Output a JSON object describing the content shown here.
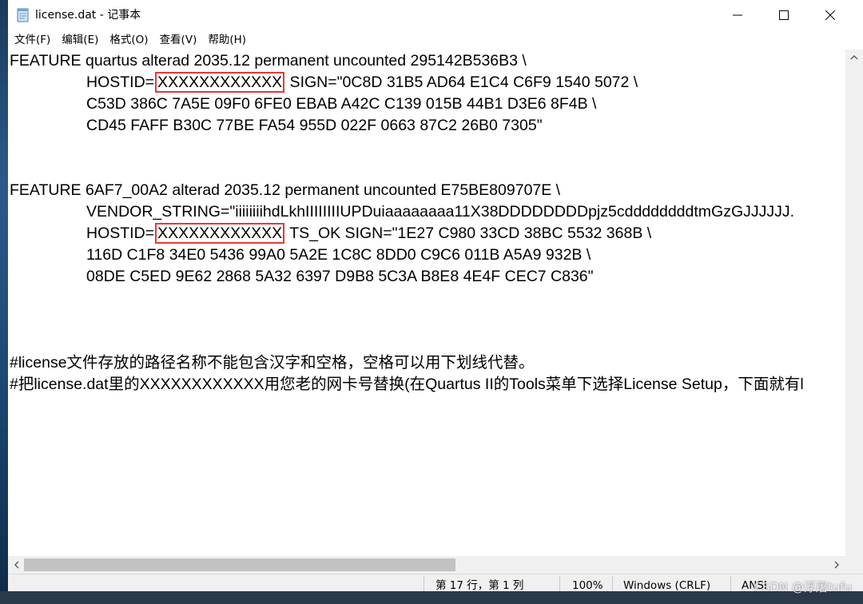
{
  "window": {
    "title": "license.dat - 记事本",
    "minimize_glyph": "—",
    "maximize_glyph": "☐",
    "close_glyph": "✕"
  },
  "menu": {
    "items": [
      "文件(F)",
      "编辑(E)",
      "格式(O)",
      "查看(V)",
      "帮助(H)"
    ]
  },
  "content": {
    "lines": {
      "l1": "FEATURE quartus alterad 2035.12 permanent uncounted 295142B536B3 \\",
      "l2_prefix": "HOSTID=",
      "l2_hostid": "XXXXXXXXXXXX",
      "l2_suffix": " SIGN=\"0C8D 31B5 AD64 E1C4 C6F9 1540 5072 \\",
      "l3": "C53D 386C 7A5E 09F0 6FE0 EBAB A42C C139 015B 44B1 D3E6 8F4B \\",
      "l4": "CD45 FAFF B30C 77BE FA54 955D 022F 0663 87C2 26B0 7305\"",
      "l5": "FEATURE 6AF7_00A2 alterad 2035.12 permanent uncounted E75BE809707E \\",
      "l6": "VENDOR_STRING=\"iiiiiiiihdLkhIIIIIIIIUPDuiaaaaaaaa11X38DDDDDDDDpjz5cddddddddtmGzGJJJJJJ.",
      "l7_prefix": "HOSTID=",
      "l7_hostid": "XXXXXXXXXXXX",
      "l7_suffix": " TS_OK SIGN=\"1E27 C980 33CD 38BC 5532 368B \\",
      "l8": "116D C1F8 34E0 5436 99A0 5A2E 1C8C 8DD0 C9C6 011B A5A9 932B \\",
      "l9": "08DE C5ED 9E62 2868 5A32 6397 D9B8 5C3A B8E8 4E4F CEC7 C836\"",
      "l10": "#license文件存放的路径名称不能包含汉字和空格，空格可以用下划线代替。",
      "l11": "#把license.dat里的XXXXXXXXXXXX用您老的网卡号替换(在Quartus II的Tools菜单下选择License Setup，下面就有l"
    }
  },
  "status": {
    "position": "第 17 行，第 1 列",
    "zoom": "100%",
    "line_ending": "Windows (CRLF)",
    "encoding": "ANSI"
  },
  "watermark": "CSDN @浮屠tufu"
}
